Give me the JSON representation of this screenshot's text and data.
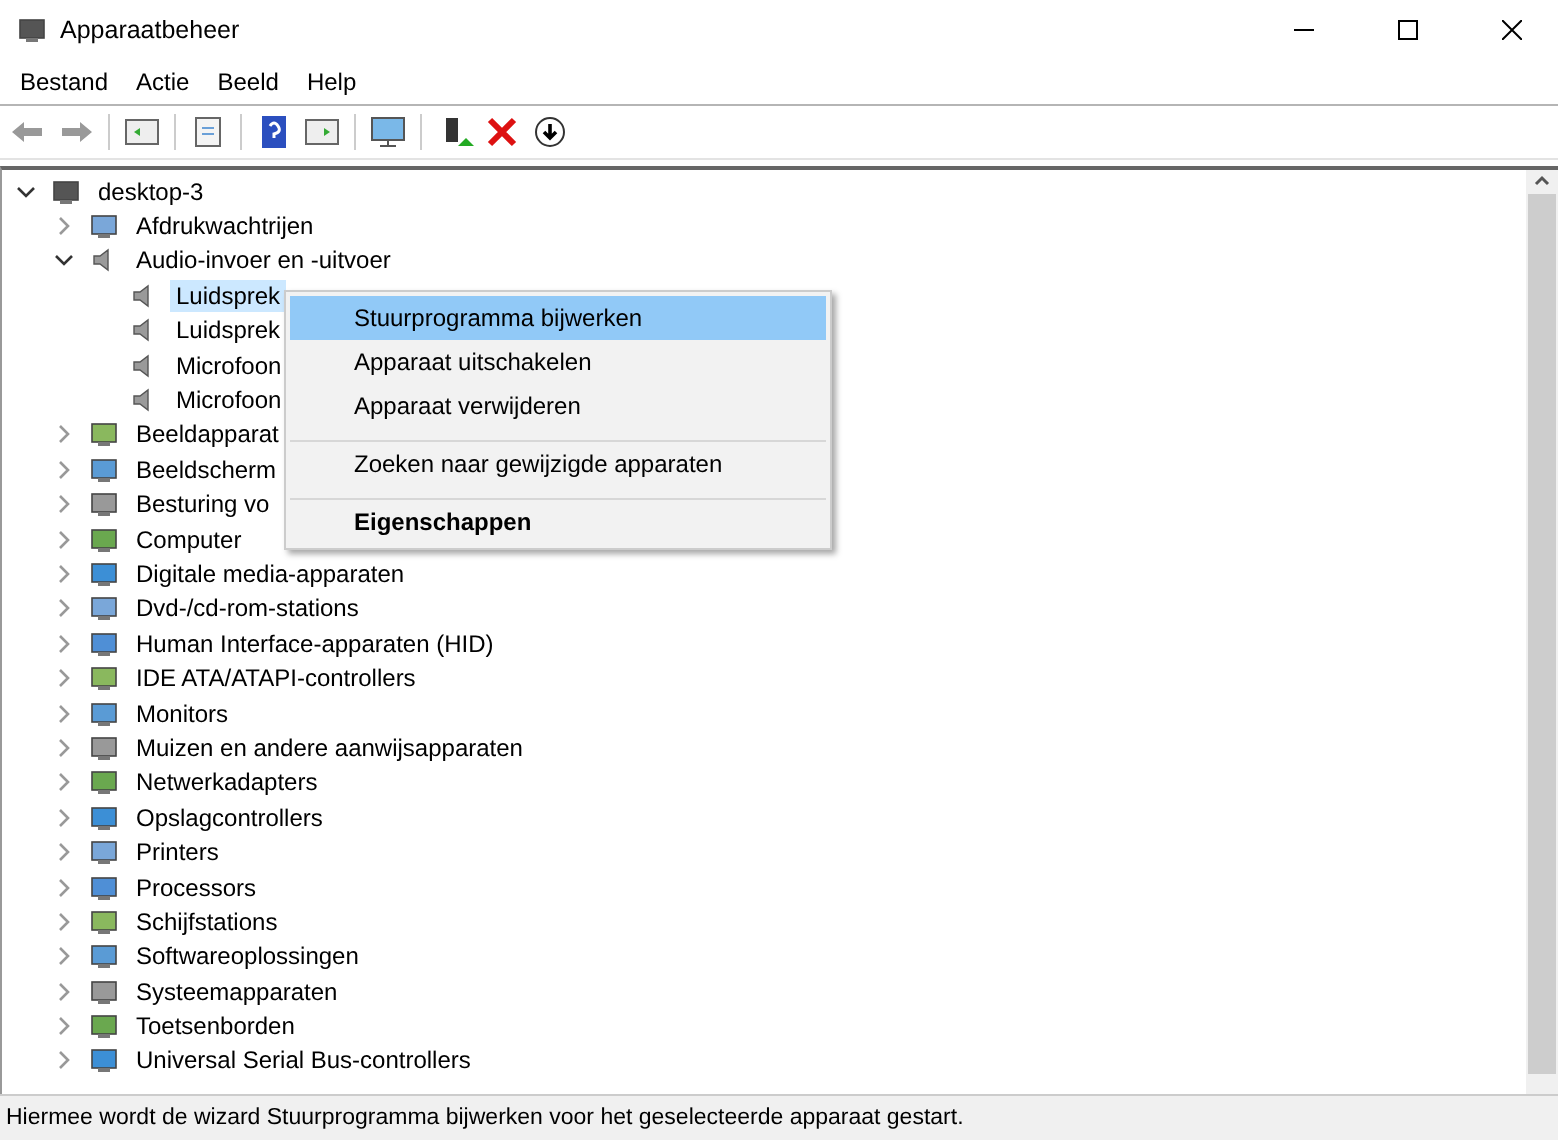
{
  "window": {
    "title": "Apparaatbeheer"
  },
  "menu_bar": [
    "Bestand",
    "Actie",
    "Beeld",
    "Help"
  ],
  "tree": {
    "label": "desktop-3",
    "expanded": true,
    "children": [
      {
        "label": "Afdrukwachtrijen",
        "expanded": false
      },
      {
        "label": "Audio-invoer en -uitvoer",
        "expanded": true,
        "children": [
          {
            "label": "Luidsprek",
            "selected": true
          },
          {
            "label": "Luidsprek",
            "selected": false
          },
          {
            "label": "Microfoon",
            "selected": false
          },
          {
            "label": "Microfoon",
            "selected": false
          }
        ]
      },
      {
        "label": "Beeldapparat",
        "expanded": false
      },
      {
        "label": "Beeldscherm",
        "expanded": false
      },
      {
        "label": "Besturing vo",
        "expanded": false
      },
      {
        "label": "Computer",
        "expanded": false
      },
      {
        "label": "Digitale media-apparaten",
        "expanded": false
      },
      {
        "label": "Dvd-/cd-rom-stations",
        "expanded": false
      },
      {
        "label": "Human Interface-apparaten (HID)",
        "expanded": false
      },
      {
        "label": "IDE ATA/ATAPI-controllers",
        "expanded": false
      },
      {
        "label": "Monitors",
        "expanded": false
      },
      {
        "label": "Muizen en andere aanwijsapparaten",
        "expanded": false
      },
      {
        "label": "Netwerkadapters",
        "expanded": false
      },
      {
        "label": "Opslagcontrollers",
        "expanded": false
      },
      {
        "label": "Printers",
        "expanded": false
      },
      {
        "label": "Processors",
        "expanded": false
      },
      {
        "label": "Schijfstations",
        "expanded": false
      },
      {
        "label": "Softwareoplossingen",
        "expanded": false
      },
      {
        "label": "Systeemapparaten",
        "expanded": false
      },
      {
        "label": "Toetsenborden",
        "expanded": false
      },
      {
        "label": "Universal Serial Bus-controllers",
        "expanded": false
      }
    ]
  },
  "context_menu": [
    {
      "label": "Stuurprogramma bijwerken",
      "selected": true,
      "bold": false,
      "separator_before": false
    },
    {
      "label": "Apparaat uitschakelen",
      "selected": false,
      "bold": false,
      "separator_before": false
    },
    {
      "label": "Apparaat verwijderen",
      "selected": false,
      "bold": false,
      "separator_before": false
    },
    {
      "label": "Zoeken naar gewijzigde apparaten",
      "selected": false,
      "bold": false,
      "separator_before": true
    },
    {
      "label": "Eigenschappen",
      "selected": false,
      "bold": true,
      "separator_before": true
    }
  ],
  "status_bar": "Hiermee wordt de wizard Stuurprogramma bijwerken voor het geselecteerde apparaat gestart."
}
